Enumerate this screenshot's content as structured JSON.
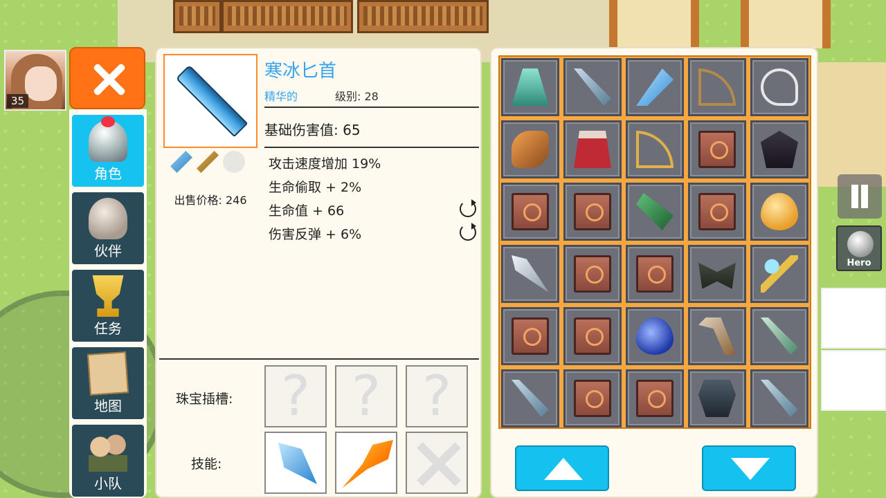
{
  "player": {
    "level": "35"
  },
  "hud": {
    "hero_label": "Hero"
  },
  "nav": {
    "items": [
      {
        "label": "角色",
        "icon": "helmet-icon",
        "active": true
      },
      {
        "label": "伙伴",
        "icon": "viking-helmet-icon",
        "active": false
      },
      {
        "label": "任务",
        "icon": "trophy-icon",
        "active": false
      },
      {
        "label": "地图",
        "icon": "map-scroll-icon",
        "active": false
      },
      {
        "label": "小队",
        "icon": "team-icon",
        "active": false
      }
    ]
  },
  "item": {
    "name": "寒冰匕首",
    "quality": "精华的",
    "level": "级别: 28",
    "sell_price": "出售价格: 246",
    "base_damage": "基础伤害值: 65",
    "stats": [
      "攻击速度增加 19%",
      "生命偷取 + 2%",
      "生命值 + 66",
      "伤害反弹 + 6%"
    ],
    "gem_slots_label": "珠宝插槽:",
    "skills_label": "技能:"
  },
  "inventory": {
    "items": [
      "cloak",
      "sword",
      "dagger",
      "bow",
      "sling",
      "horn",
      "cape",
      "bow2",
      "book",
      "dark",
      "book",
      "book",
      "claw",
      "book",
      "gem",
      "kunai",
      "book",
      "book",
      "moth",
      "staff",
      "book",
      "book",
      "drop",
      "scythe",
      "green",
      "sword",
      "book",
      "book",
      "armor",
      "sword"
    ]
  },
  "colors": {
    "accent": "#16c2ef",
    "close": "#ff7316",
    "item_name": "#36a3ef",
    "grid": "#f5a742"
  }
}
